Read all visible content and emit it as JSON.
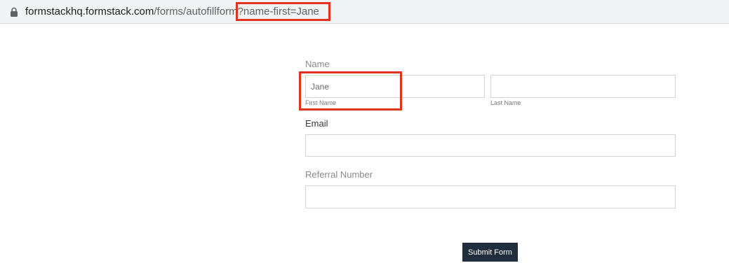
{
  "browser": {
    "url_host": "formstackhq.formstack.com",
    "url_path": "/forms/autofillform",
    "url_query": "?name-first=Jane"
  },
  "form": {
    "name_label": "Name",
    "first_name_value": "Jane",
    "first_name_sublabel": "First Name",
    "last_name_value": "",
    "last_name_sublabel": "Last Name",
    "email_label": "Email",
    "email_value": "",
    "referral_label": "Referral Number",
    "referral_value": "",
    "submit_label": "Submit Form"
  },
  "colors": {
    "highlight": "#e0341e",
    "submit_bg": "#1f2d3d"
  }
}
